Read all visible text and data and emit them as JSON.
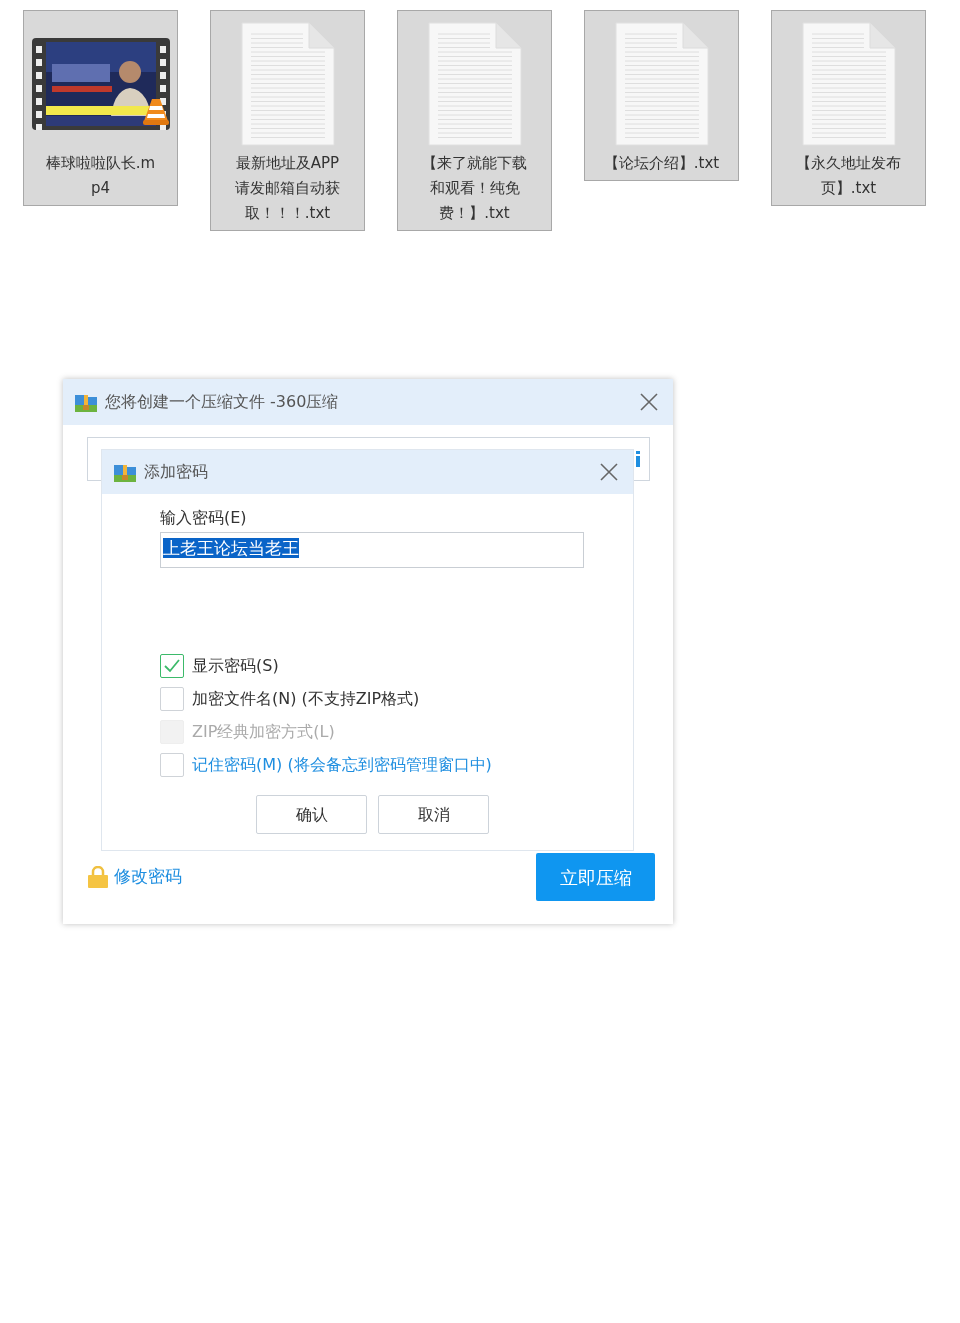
{
  "files": [
    {
      "kind": "video",
      "name": "棒球啦啦队长.mp4",
      "selected": true
    },
    {
      "kind": "text",
      "name": "最新地址及APP请发邮箱自动获取！！！.txt",
      "selected": true
    },
    {
      "kind": "text",
      "name": "【来了就能下载和观看！纯免费！】.txt",
      "selected": true
    },
    {
      "kind": "text",
      "name": "【论坛介绍】.txt",
      "selected": true
    },
    {
      "kind": "text",
      "name": "【永久地址发布页】.txt",
      "selected": true
    }
  ],
  "dialog": {
    "title": "您将创建一个压缩文件 -360压缩",
    "change_password_link": "修改密码",
    "compress_button": "立即压缩"
  },
  "password_dialog": {
    "title": "添加密码",
    "field_label": "输入密码(E)",
    "value": "上老王论坛当老王",
    "options": [
      {
        "kind": "plain",
        "label": "显示密码(S)",
        "checked": true,
        "disabled": false
      },
      {
        "kind": "plain",
        "label": "加密文件名(N) (不支持ZIP格式)",
        "checked": false,
        "disabled": false
      },
      {
        "kind": "plain",
        "label": "ZIP经典加密方式(L)",
        "checked": false,
        "disabled": true
      },
      {
        "kind": "link",
        "label": "记住密码(M) (将会备忘到密码管理窗口中)",
        "checked": false,
        "disabled": false
      }
    ],
    "buttons": [
      "确认",
      "取消"
    ]
  }
}
